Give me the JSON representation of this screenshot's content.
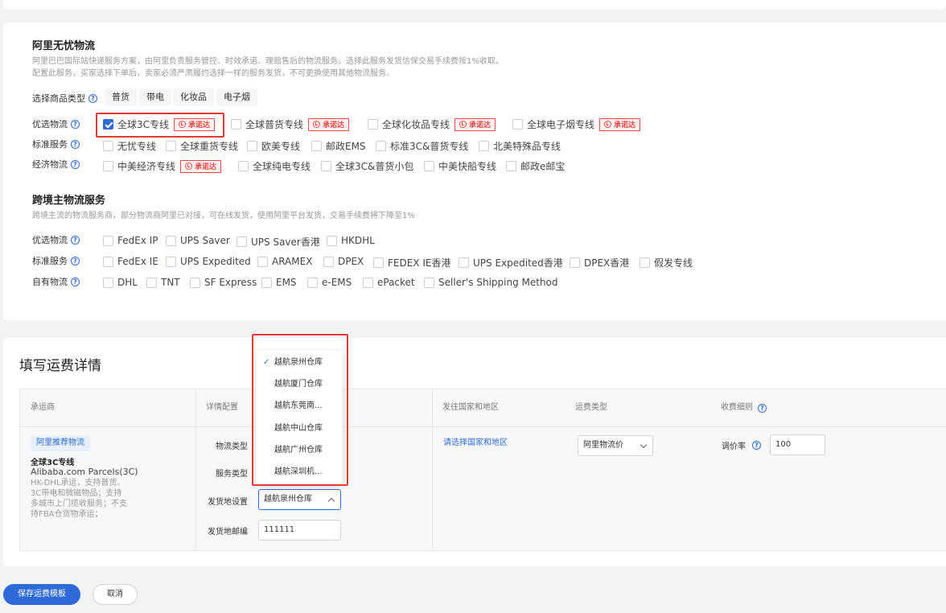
{
  "ali_logistics": {
    "title": "阿里无忧物流",
    "desc1": "阿里巴巴国际站快递服务方案，由阿里负责服务管控、时效承诺、理赔售后的物流服务。选择此服务发货信保交易手续费按1%收取。",
    "desc2": "配置此服务，买家选择下单后，卖家必须严肃履约选择一样的服务发货，不可更换使用其他物流服务。",
    "category_label": "选择商品类型",
    "categories": [
      "普货",
      "带电",
      "化妆品",
      "电子烟"
    ],
    "preferred_label": "优选物流",
    "preferred": [
      {
        "label": "全球3C专线",
        "checked": true,
        "badge": "承诺达"
      },
      {
        "label": "全球普货专线",
        "checked": false,
        "badge": "承诺达"
      },
      {
        "label": "全球化妆品专线",
        "checked": false,
        "badge": "承诺达"
      },
      {
        "label": "全球电子烟专线",
        "checked": false,
        "badge": "承诺达"
      }
    ],
    "standard_label": "标准服务",
    "standard": [
      "无忧专线",
      "全球重货专线",
      "欧美专线",
      "邮政EMS",
      "标准3C&普货专线",
      "北美特殊品专线"
    ],
    "economy_label": "经济物流",
    "economy": [
      {
        "label": "中美经济专线",
        "badge": "承诺达"
      },
      {
        "label": "全球纯电专线"
      },
      {
        "label": "全球3C&普货小包"
      },
      {
        "label": "中美快船专线"
      },
      {
        "label": "邮政e邮宝"
      }
    ]
  },
  "cross_border": {
    "title": "跨境主物流服务",
    "desc": "跨境主流的物流服务商，部分物流商阿里已对接，可在线发货，使用阿里平台发货，交易手续费将下降至1%",
    "preferred_label": "优选物流",
    "preferred": [
      "FedEx IP",
      "UPS Saver",
      "UPS Saver香港",
      "HKDHL"
    ],
    "standard_label": "标准服务",
    "standard": [
      "FedEx IE",
      "UPS Expedited",
      "ARAMEX",
      "DPEX",
      "FEDEX IE香港",
      "UPS Expedited香港",
      "DPEX香港",
      "假发专线"
    ],
    "own_label": "自有物流",
    "own": [
      "DHL",
      "TNT",
      "SF Express",
      "EMS",
      "e-EMS",
      "ePacket",
      "Seller's Shipping Method"
    ]
  },
  "fee_details": {
    "title": "填写运费详情",
    "headers": {
      "carrier": "承运商",
      "config": "详情配置",
      "country": "发往国家和地区",
      "fee_type": "运费类型",
      "fee_rule": "收费细则"
    },
    "carrier_tag": "阿里推荐物流",
    "carrier_name": "全球3C专线",
    "carrier_sub": "Alibaba.com Parcels(3C)",
    "carrier_desc": "HK-DHL承运，支持普货、3C带电和微磁物品；支持多城市上门揽收服务；不支持FBA仓货物承运；",
    "logistics_type_label": "物流类型",
    "service_type_label": "服务类型",
    "origin_label": "发货地设置",
    "origin_value": "越航泉州仓库",
    "postcode_label": "发货地邮编",
    "postcode_value": "111111",
    "country_link": "请选择国家和地区",
    "fee_type_value": "阿里物流价",
    "markup_label": "调价率",
    "markup_value": "100"
  },
  "dropdown": {
    "options": [
      "越航泉州仓库",
      "越航厦门仓库",
      "越航东莞南...",
      "越航中山仓库",
      "越航广州仓库",
      "越航深圳机..."
    ],
    "selected_index": 0
  },
  "buttons": {
    "save": "保存运费模板",
    "cancel": "取消"
  }
}
